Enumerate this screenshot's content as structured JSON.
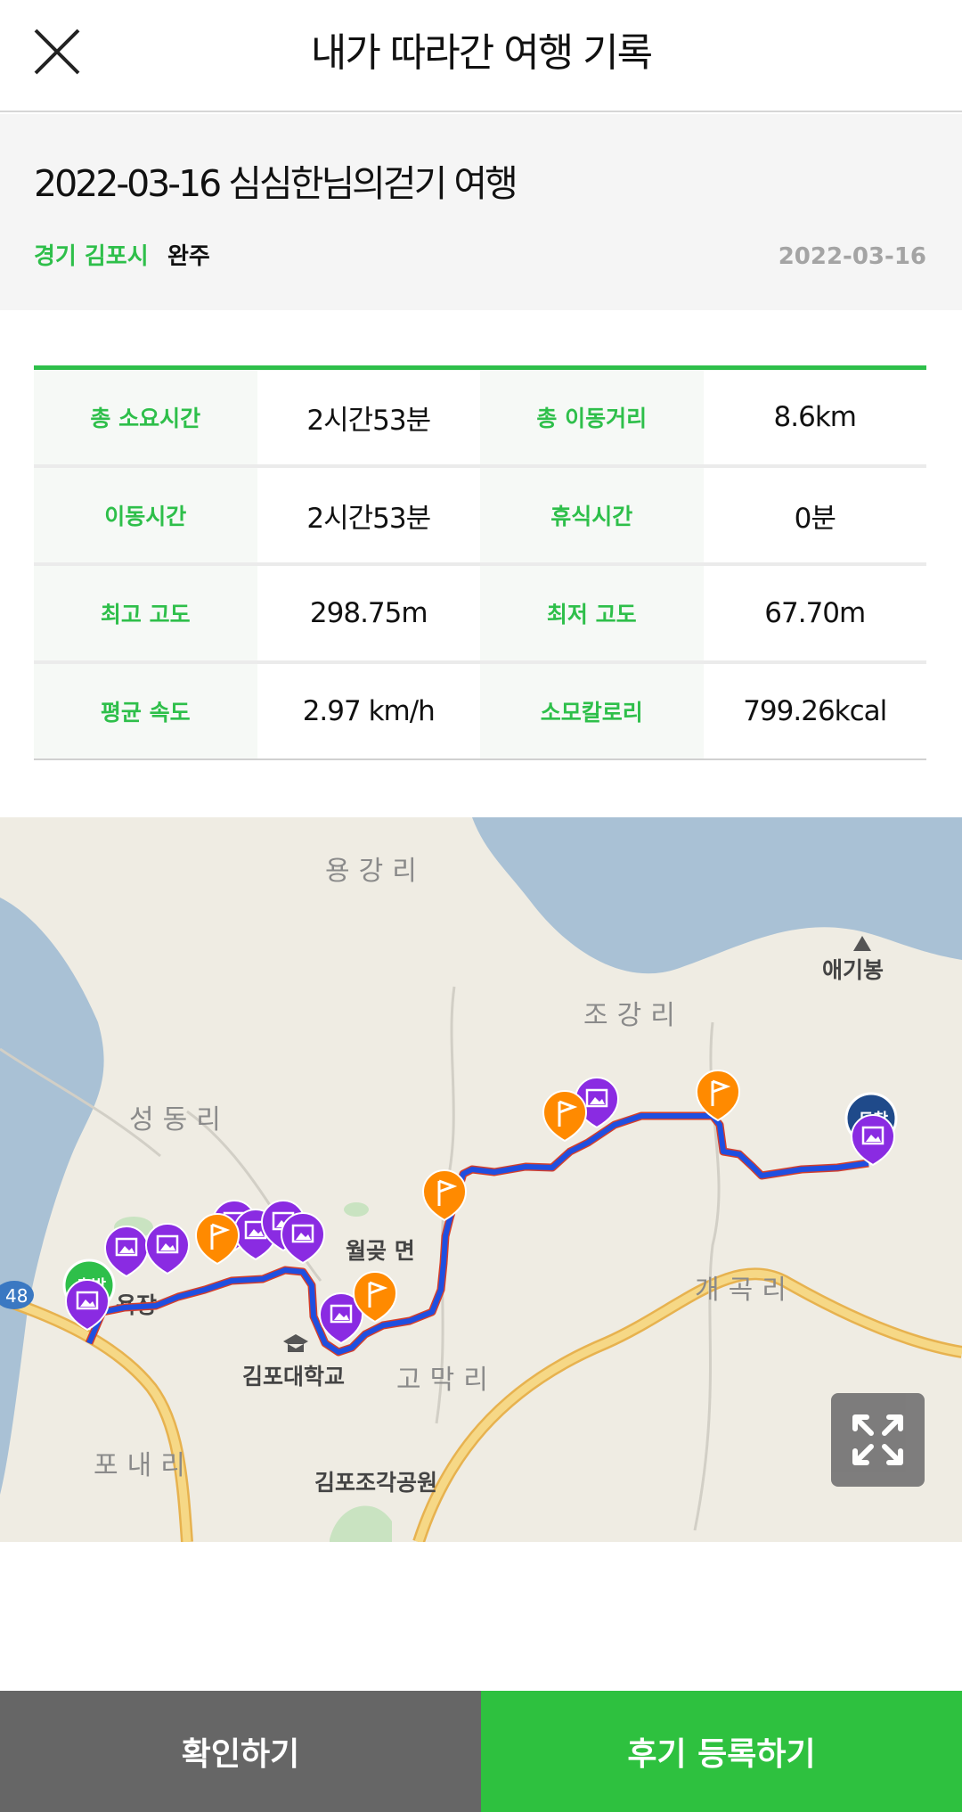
{
  "header": {
    "title": "내가 따라간 여행 기록",
    "close_icon": "close-icon"
  },
  "summary": {
    "trip_title": "2022-03-16 심심한님의걷기 여행",
    "region": "경기 김포시",
    "status": "완주",
    "date": "2022-03-16"
  },
  "stats": [
    [
      {
        "label": "총 소요시간",
        "value": "2시간53분"
      },
      {
        "label": "총 이동거리",
        "value": "8.6km"
      }
    ],
    [
      {
        "label": "이동시간",
        "value": "2시간53분"
      },
      {
        "label": "휴식시간",
        "value": "0분"
      }
    ],
    [
      {
        "label": "최고 고도",
        "value": "298.75m"
      },
      {
        "label": "최저 고도",
        "value": "67.70m"
      }
    ],
    [
      {
        "label": "평균 속도",
        "value": "2.97 km/h"
      },
      {
        "label": "소모칼로리",
        "value": "799.26kcal"
      }
    ]
  ],
  "map": {
    "labels": {
      "yonggang": "용강리",
      "aegibong": "애기봉",
      "jogang": "조강리",
      "seongdong": "성동리",
      "wolgot": "월곶 면",
      "gaegok": "개곡리",
      "gomak": "고막리",
      "gimpo_univ": "김포대학교",
      "ponae": "포내리",
      "sculpture_park": "김포조각공원",
      "road_48": "48",
      "partial_label": "욕장",
      "start_marker": "출발",
      "end_marker": "도착"
    },
    "icons": {
      "photo": "photo-marker-icon",
      "flag": "flag-marker-icon",
      "expand": "expand-icon",
      "mountain": "mountain-icon",
      "school": "school-icon"
    },
    "colors": {
      "route": "#1f4fe0",
      "photo_marker": "#8a2be2",
      "flag_marker": "#ff8a00",
      "water": "#a9c1d5",
      "land": "#efece3",
      "green": "#2ebf4a"
    }
  },
  "buttons": {
    "confirm": "확인하기",
    "review": "후기 등록하기"
  }
}
